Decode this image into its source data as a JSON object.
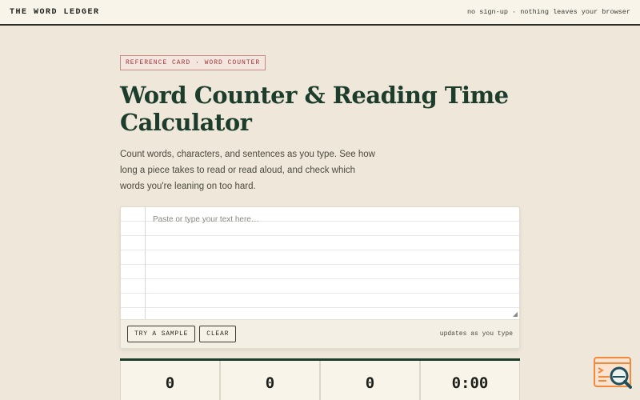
{
  "header": {
    "brand": "THE WORD LEDGER",
    "tagline": "no sign-up · nothing leaves your browser"
  },
  "hero": {
    "kicker": "REFERENCE CARD · WORD COUNTER",
    "title": "Word Counter & Reading Time Calculator",
    "description": "Count words, characters, and sentences as you type. See how long a piece takes to read or read aloud, and check which words you're leaning on too hard."
  },
  "editor": {
    "placeholder": "Paste or type your text here…",
    "sample_label": "TRY A SAMPLE",
    "clear_label": "CLEAR",
    "live_note": "updates as you type"
  },
  "stats": [
    "0",
    "0",
    "0",
    "0:00"
  ],
  "colors": {
    "background": "#efe7d9",
    "accent_green": "#1d3d2c",
    "kicker_red": "#a0363a",
    "fab_orange": "#f08a3e"
  },
  "icons": {
    "floating_widget": "search-window-icon",
    "resize": "resize-grip-icon"
  }
}
